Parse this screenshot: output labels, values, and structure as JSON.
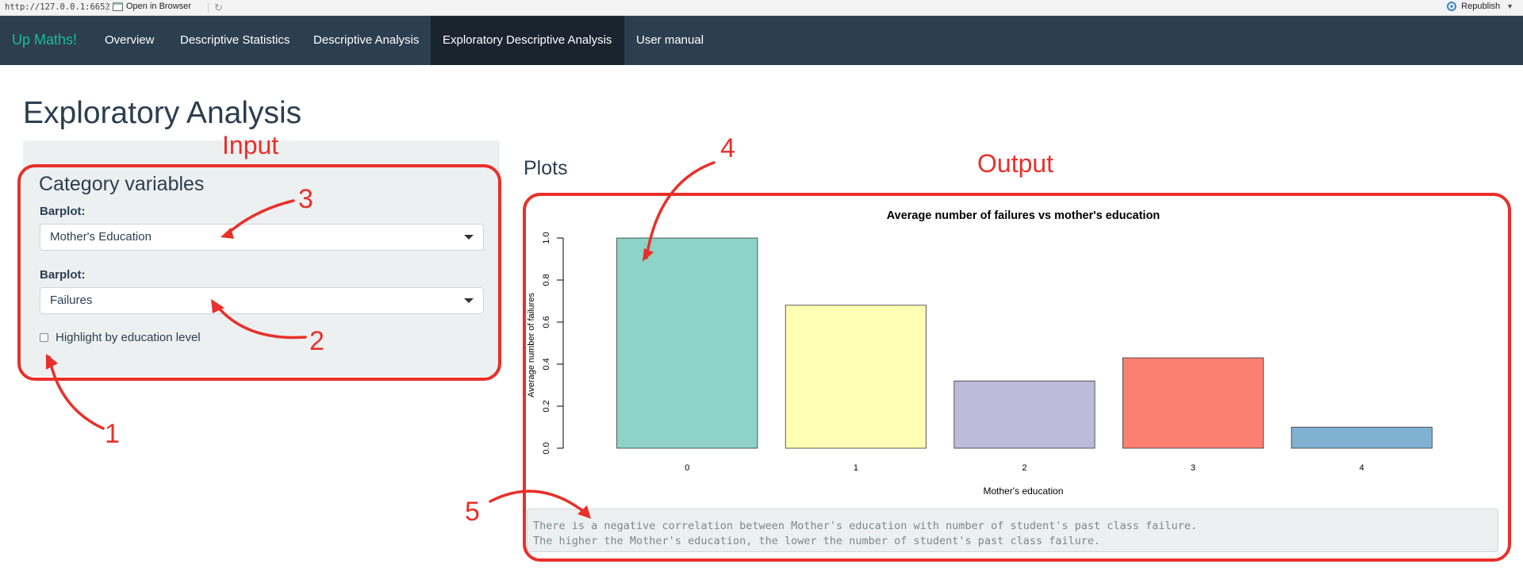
{
  "viewer": {
    "url": "http://127.0.0.1:6652",
    "open_in_browser": "Open in Browser",
    "republish": "Republish"
  },
  "navbar": {
    "brand": "Up Maths!",
    "tabs": [
      {
        "label": "Overview"
      },
      {
        "label": "Descriptive Statistics"
      },
      {
        "label": "Descriptive Analysis"
      },
      {
        "label": "Exploratory Descriptive Analysis",
        "active": true
      },
      {
        "label": "User manual"
      }
    ]
  },
  "page": {
    "title": "Exploratory Analysis"
  },
  "sidebar": {
    "title": "Category variables",
    "select1": {
      "label": "Barplot:",
      "value": "Mother's Education"
    },
    "select2": {
      "label": "Barplot:",
      "value": "Failures"
    },
    "checkbox": {
      "label": "Highlight by education level",
      "checked": false
    }
  },
  "main": {
    "plots_title": "Plots",
    "verbatim_line1": "There is a negative correlation between Mother's education with number of student's past class failure.",
    "verbatim_line2": "The higher the Mother's education, the lower the number of student's past class failure."
  },
  "annotations": {
    "input": "Input",
    "output": "Output",
    "n1": "1",
    "n2": "2",
    "n3": "3",
    "n4": "4",
    "n5": "5",
    "color": "#e8302a"
  },
  "colors": {
    "navbar": "#2c3e50",
    "navbar_active": "#1a242f",
    "brand": "#18bc9c",
    "well": "#ecf0f1"
  },
  "chart_data": {
    "type": "bar",
    "title": "Average number of failures vs mother's education",
    "xlabel": "Mother's education",
    "ylabel": "Average number of failures",
    "categories": [
      "0",
      "1",
      "2",
      "3",
      "4"
    ],
    "values": [
      1.0,
      0.68,
      0.32,
      0.43,
      0.1
    ],
    "colors": [
      "#8dd3c7",
      "#ffffb3",
      "#bebada",
      "#fb8072",
      "#80b1d3"
    ],
    "ylim": [
      0,
      1.0
    ],
    "yticks": [
      "0.0",
      "0.2",
      "0.4",
      "0.6",
      "0.8",
      "1.0"
    ],
    "grid": false
  }
}
